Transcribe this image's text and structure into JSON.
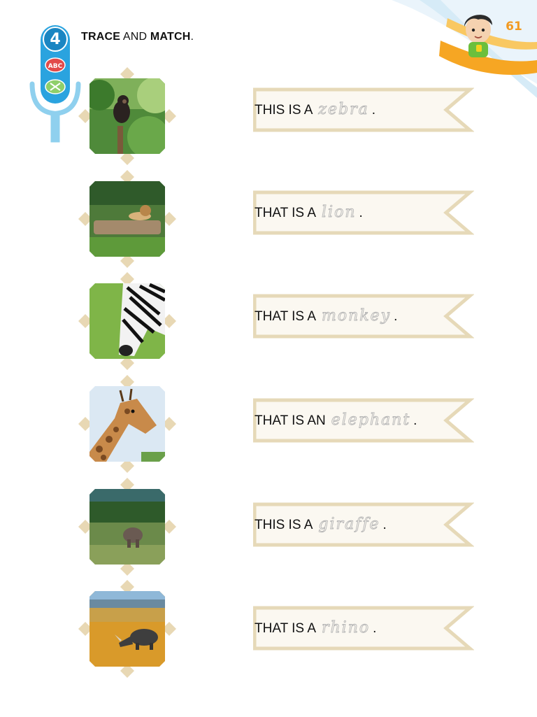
{
  "page": {
    "number": "61"
  },
  "activity": {
    "number": "4",
    "instruction_words": [
      {
        "text": "TRACE",
        "bold": true
      },
      {
        "text": " AND ",
        "bold": false
      },
      {
        "text": "MATCH",
        "bold": true
      },
      {
        "text": ".",
        "bold": false
      }
    ]
  },
  "pictures": [
    {
      "animal": "chimpanzee"
    },
    {
      "animal": "lion"
    },
    {
      "animal": "zebra"
    },
    {
      "animal": "giraffe"
    },
    {
      "animal": "elephant"
    },
    {
      "animal": "rhino"
    }
  ],
  "sentences": [
    {
      "prefix": "THIS IS A",
      "trace_word": "zebra",
      "end": "."
    },
    {
      "prefix": "THAT IS A",
      "trace_word": "lion",
      "end": "."
    },
    {
      "prefix": "THAT IS A",
      "trace_word": "monkey",
      "end": "."
    },
    {
      "prefix": "THAT IS AN",
      "trace_word": "elephant",
      "end": "."
    },
    {
      "prefix": "THIS IS A",
      "trace_word": "giraffe",
      "end": "."
    },
    {
      "prefix": "THAT IS A",
      "trace_word": "rhino",
      "end": "."
    }
  ],
  "colors": {
    "accent_blue": "#2aa3df",
    "banner_border": "#e6d9b8",
    "banner_fill": "#fbf8f1",
    "tile_frame": "#e8d8b4",
    "page_number": "#f29a22"
  }
}
